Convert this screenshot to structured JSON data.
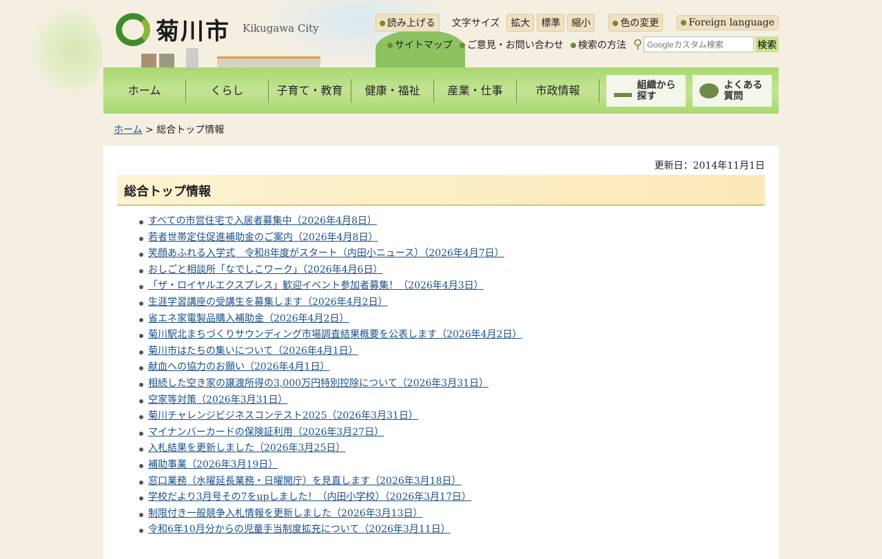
{
  "header": {
    "logo_text": "菊川市",
    "logo_en": "Kikugawa City",
    "read_aloud": "読み上げる",
    "font_size_label": "文字サイズ",
    "font_large": "拡大",
    "font_normal": "標準",
    "font_small": "縮小",
    "color_change": "色の変更",
    "foreign_language": "Foreign language",
    "sitemap": "サイトマップ",
    "contact": "ご意見・お問い合わせ",
    "search_help": "検索の方法",
    "search_placeholder": "Googleカスタム検索",
    "search_button": "検索"
  },
  "nav": {
    "items": [
      "ホーム",
      "くらし",
      "子育て・教育",
      "健康・福祉",
      "産業・仕事",
      "市政情報"
    ],
    "org_search": "組織から探す",
    "faq": "よくある質問"
  },
  "breadcrumb": {
    "home": "ホーム",
    "sep": " > ",
    "current": "総合トップ情報"
  },
  "main": {
    "updated": "更新日：2014年11月1日",
    "title": "総合トップ情報",
    "items": [
      "すべての市営住宅で入居者募集中（2026年4月8日）",
      "若者世帯定住促進補助金のご案内（2026年4月8日）",
      "笑顔あふれる入学式　令和8年度がスタート（内田小ニュース）（2026年4月7日）",
      "おしごと相談所「なでしこワーク」（2026年4月6日）",
      "「ザ・ロイヤルエクスプレス」歓迎イベント参加者募集！（2026年4月3日）",
      "生涯学習講座の受講生を募集します（2026年4月2日）",
      "省エネ家電製品購入補助金（2026年4月2日）",
      "菊川駅北まちづくりサウンディング市場調査結果概要を公表します（2026年4月2日）",
      "菊川市はたちの集いについて（2026年4月1日）",
      "献血への協力のお願い（2026年4月1日）",
      "相続した空き家の譲渡所得の3,000万円特別控除について（2026年3月31日）",
      "空家等対策（2026年3月31日）",
      "菊川チャレンジビジネスコンテスト2025（2026年3月31日）",
      "マイナンバーカードの保険証利用（2026年3月27日）",
      "入札結果を更新しました（2026年3月25日）",
      "補助事業（2026年3月19日）",
      "窓口業務（水曜延長業務・日曜開庁）を見直します（2026年3月18日）",
      "学校だより3月号その7をupしました！（内田小学校）（2026年3月17日）",
      "制限付き一般競争入札情報を更新しました（2026年3月13日）",
      "令和6年10月分からの児童手当制度拡充について（2026年3月11日）"
    ]
  }
}
